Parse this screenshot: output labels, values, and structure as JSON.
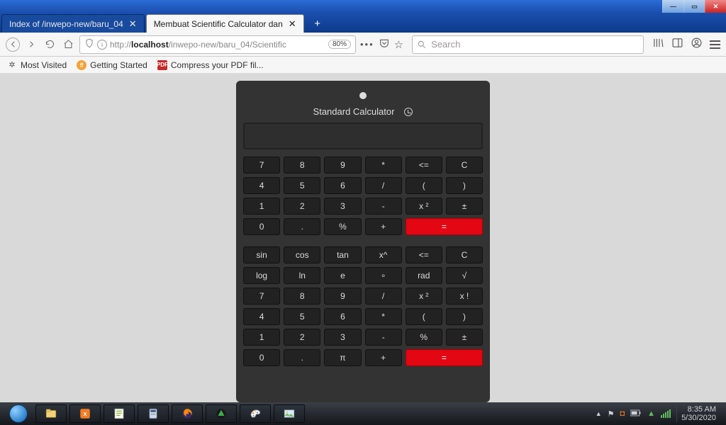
{
  "window_controls": {
    "min": "—",
    "max": "▭",
    "close": "✕"
  },
  "tabs": [
    {
      "title": "Index of /inwepo-new/baru_04",
      "active": false
    },
    {
      "title": "Membuat Scientific Calculator dan",
      "active": true
    }
  ],
  "address": {
    "pre": "http://",
    "host": "localhost",
    "path": "/inwepo-new/baru_04/Scientific",
    "zoom": "80%"
  },
  "search": {
    "placeholder": "Search"
  },
  "bookmarks": [
    {
      "icon": "gear",
      "label": "Most Visited"
    },
    {
      "icon": "ff",
      "label": "Getting Started"
    },
    {
      "icon": "pdf",
      "label": "Compress your PDF fil..."
    }
  ],
  "calc": {
    "title": "Standard Calculator",
    "rows_top": [
      [
        "7",
        "8",
        "9",
        "*",
        "<=",
        "C"
      ],
      [
        "4",
        "5",
        "6",
        "/",
        "(",
        ")"
      ],
      [
        "1",
        "2",
        "3",
        "-",
        "x ²",
        "±"
      ],
      [
        "0",
        ".",
        "%",
        "+",
        "=",
        "="
      ]
    ],
    "rows_bottom": [
      [
        "sin",
        "cos",
        "tan",
        "x^",
        "<=",
        "C"
      ],
      [
        "log",
        "ln",
        "e",
        "∘",
        "rad",
        "√"
      ],
      [
        "7",
        "8",
        "9",
        "/",
        "x ²",
        "x !"
      ],
      [
        "4",
        "5",
        "6",
        "*",
        "(",
        ")"
      ],
      [
        "1",
        "2",
        "3",
        "-",
        "%",
        "±"
      ],
      [
        "0",
        ".",
        "π",
        "+",
        "=",
        "="
      ]
    ]
  },
  "tray": {
    "time": "8:35 AM",
    "date": "5/30/2020"
  }
}
